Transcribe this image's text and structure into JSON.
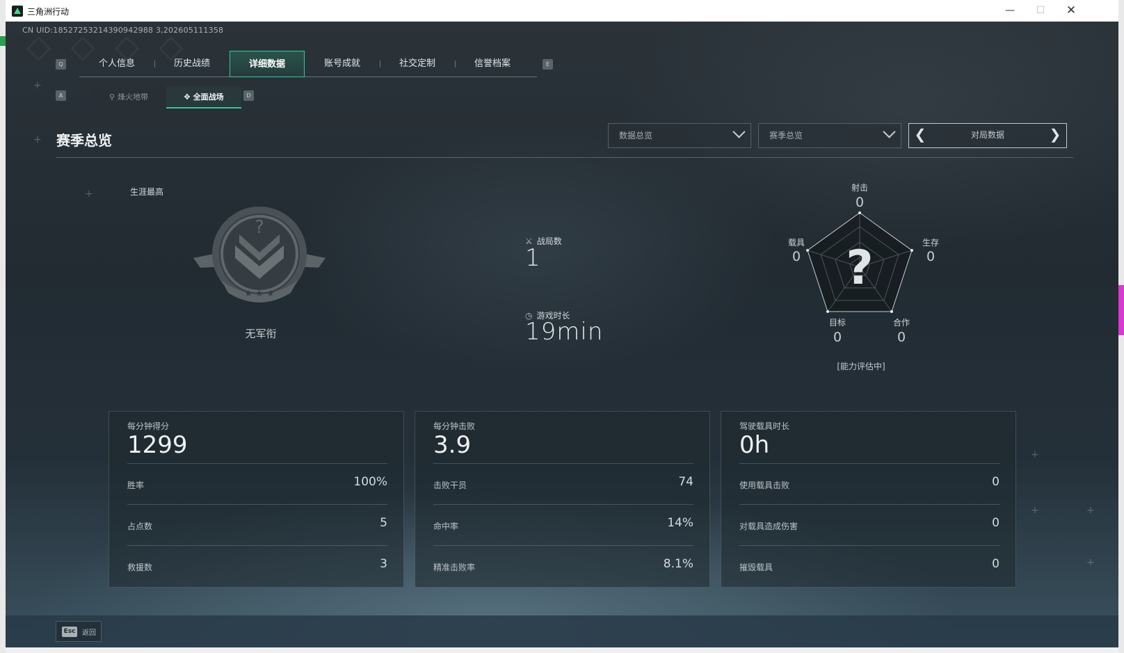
{
  "window": {
    "title": "三角洲行动"
  },
  "uid": "CN UID:18527253214390942988 3,202605111358",
  "tabs": {
    "left_key": "Q",
    "right_key": "E",
    "items": [
      {
        "label": "个人信息",
        "active": false
      },
      {
        "label": "历史战绩",
        "active": false
      },
      {
        "label": "详细数据",
        "active": true
      },
      {
        "label": "账号成就",
        "active": false
      },
      {
        "label": "社交定制",
        "active": false
      },
      {
        "label": "信誉档案",
        "active": false
      }
    ]
  },
  "subtabs": {
    "left_key": "A",
    "right_key": "D",
    "items": [
      {
        "label": "烽火地带",
        "icon": "drop-icon",
        "active": false
      },
      {
        "label": "全面战场",
        "icon": "crosshair-icon",
        "active": true
      }
    ]
  },
  "section": {
    "title": "赛季总览",
    "filter1": "数据总览",
    "filter2": "赛季总览",
    "pager_label": "对局数据"
  },
  "career": {
    "label": "生涯最高",
    "rank": "无军衔"
  },
  "summary": {
    "matches_label": "战局数",
    "matches_value": "1",
    "playtime_label": "游戏时长",
    "playtime_value": "19min"
  },
  "radar": {
    "shoot_label": "射击",
    "shoot_value": "0",
    "survive_label": "生存",
    "survive_value": "0",
    "coop_label": "合作",
    "coop_value": "0",
    "target_label": "目标",
    "target_value": "0",
    "vehicle_label": "载具",
    "vehicle_value": "0",
    "status": "[能力评估中]",
    "center_glyph": "?"
  },
  "cards": [
    {
      "header": "每分钟得分",
      "value": "1299",
      "rows": [
        {
          "k": "胜率",
          "v": "100%"
        },
        {
          "k": "占点数",
          "v": "5"
        },
        {
          "k": "救援数",
          "v": "3"
        }
      ]
    },
    {
      "header": "每分钟击败",
      "value": "3.9",
      "rows": [
        {
          "k": "击败干员",
          "v": "74"
        },
        {
          "k": "命中率",
          "v": "14%"
        },
        {
          "k": "精准击败率",
          "v": "8.1%"
        }
      ]
    },
    {
      "header": "驾驶载具时长",
      "value": "0h",
      "rows": [
        {
          "k": "使用载具击败",
          "v": "0"
        },
        {
          "k": "对载具造成伤害",
          "v": "0"
        },
        {
          "k": "摧毁载具",
          "v": "0"
        }
      ]
    }
  ],
  "footer": {
    "esc_key": "Esc",
    "back_label": "返回"
  },
  "colors": {
    "accent": "#33c79a",
    "bg": "#222b32",
    "window_bg": "#ffffff"
  }
}
